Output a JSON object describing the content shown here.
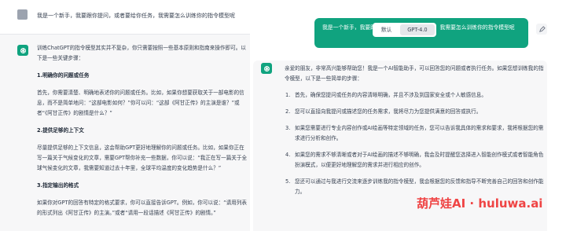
{
  "left": {
    "user_message": "我是一个新手，我要跟你提问，或者要给你任务，我需要怎么训练你的指令模型呢",
    "answer": {
      "intro": "训练ChatGPT的指令模型其实并不复杂，你只需要按照一些基本原则和指南来操作即可。以下是一些关键步骤：",
      "sections": [
        {
          "heading": "1.明确你的问题或任务",
          "body": "首先，你需要清楚、明确地表述你的问题或任务。比如，如果你想要获取关于一部电影的信息，而不是简单地问：“这部电影如何？”你可以问：“这部《阿甘正传》的主演是谁？”或者“《阿甘正传》的剧情是什么？”"
        },
        {
          "heading": "2.提供足够的上下文",
          "body": "尽量提供足够的上下文信息，这会帮助GPT更好地理解你的问题或任务。比如，如果你正在写一篇关于气候变化的文章，需要GPT帮你补充一些数据，你可以说：“我正在写一篇关于全球气候变化的文章，我需要知道过去十年里，全球平均温度的变化趋势是什么？”"
        },
        {
          "heading": "3.指定输出的格式",
          "body": "如果你对GPT的回答有特定的格式要求，你可以直接告诉GPT。例如，你可以说：“请用列表的形式列出《阿甘正传》的主演。”或者“请用一段话描述《阿甘正传》的剧情。”"
        }
      ]
    }
  },
  "right": {
    "user_message": "我是一个新手，我要跟你提问，或者要给你任务，我需要怎么训练你的指令模型呢",
    "model_switch": {
      "options": [
        "默认",
        "GPT-4.0"
      ],
      "selected": "GPT-4.0"
    },
    "answer": {
      "intro": "亲爱的朋友，非常高兴能够帮助您！我是一个AI智能助手，可以回答您的问题或者执行任务。如果您想训练我的指令模型，以下是一些简单的步骤：",
      "items": [
        "首先，确保您提问或任务的内容清晰明确，并且不涉及到国家安全或个人敏感信息。",
        "您可以直接向我提问或描述您的任务需求，我将尽力为您提供满意的回答或执行。",
        "如果您需要进行专业内容创作或AI绘画等特定领域的任务，您可以告诉我具体的需求和要求，我将根据您的需求进行分析和创作。",
        "如果您的需求不够清晰或者对于AI绘画的描述不够明确，我会及时提醒您选择进入智能创作模式或者智能角色扮演模式，以便更好地理解您的需求并进行相应的创作。",
        "您还可以通过与我进行交流来逐步训练我的指令模型，我会根据您的反馈和指导不断完善自己的回答和创作能力。"
      ]
    }
  },
  "watermark": {
    "text": "葫芦娃AI · huluwa.ai"
  },
  "colors": {
    "accent": "#10a37f",
    "watermark": "#ef4444"
  }
}
